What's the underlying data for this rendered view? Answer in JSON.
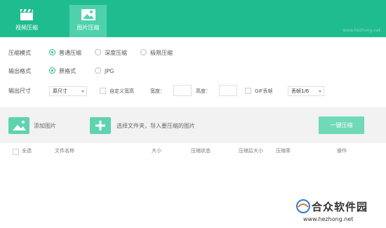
{
  "tabs": [
    {
      "label": "视频压缩",
      "icon": "clapperboard-icon",
      "active": false
    },
    {
      "label": "图片压缩",
      "icon": "image-icon",
      "active": true
    }
  ],
  "header": {
    "watermark": "www.hezhong.net"
  },
  "settings": {
    "mode": {
      "label": "压缩模式",
      "options": [
        "普通压缩",
        "深度压缩",
        "极限压缩"
      ],
      "selected": "普通压缩"
    },
    "format": {
      "label": "输出格式",
      "options": [
        "原格式",
        "JPG"
      ],
      "selected": "原格式"
    },
    "size": {
      "label": "输出尺寸",
      "select_value": "原尺寸",
      "custom_label": "自定义宽高",
      "width_label": "宽度：",
      "height_label": "高度：",
      "gif_label": "GIF丢帧",
      "gif_select_value": "丢帧1/6"
    }
  },
  "actions": {
    "add_image": "添加图片",
    "choose_folder": "选择文件夹，导入要压缩的图片",
    "compress_button": "一键压缩"
  },
  "table": {
    "select_all": "全选",
    "columns": [
      "文件名称",
      "大小",
      "压缩状态",
      "压缩后大小",
      "压缩率",
      "操作"
    ]
  },
  "watermark": {
    "title": "合众软件园",
    "url": "www.hezhong.net"
  },
  "colors": {
    "accent": "#1fbc8f",
    "active_tab": "#4fd2ac",
    "button": "#6fd9b8"
  }
}
